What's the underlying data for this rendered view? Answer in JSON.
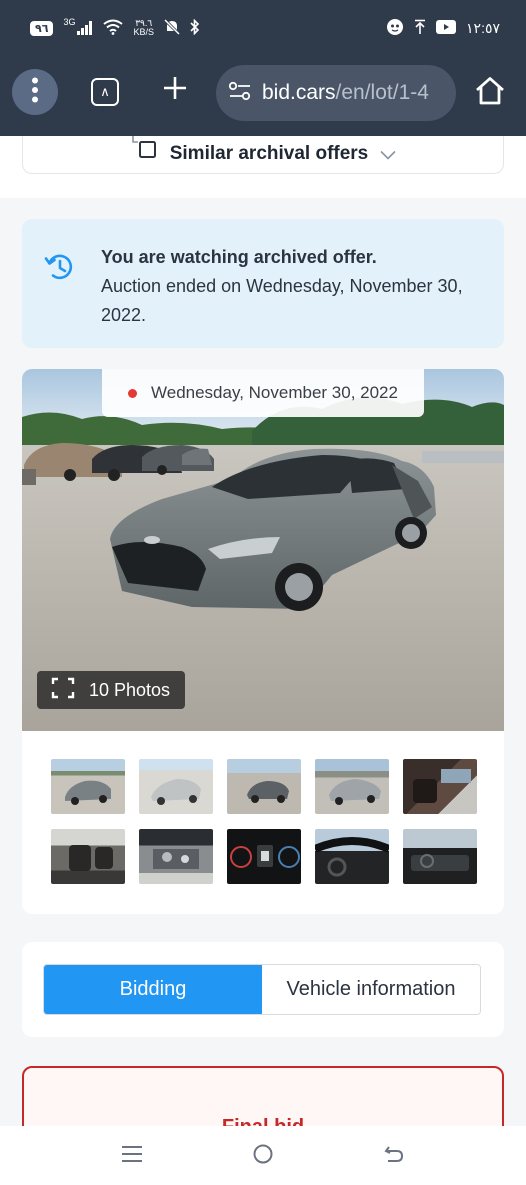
{
  "status_bar": {
    "battery": "٩٦",
    "network": "3G",
    "data_speed_value": "٣٩.٦",
    "data_speed_unit": "KB/S",
    "time": "١٢:٥٧",
    "icons": [
      "signal-icon",
      "wifi-icon",
      "mute-icon",
      "bluetooth-icon",
      "app-icon",
      "upload-icon",
      "youtube-icon"
    ]
  },
  "browser": {
    "url_domain": "bid.cars",
    "url_path": "/en/lot/1-4",
    "icons": [
      "menu-dots-icon",
      "tabs-icon",
      "new-tab-icon",
      "site-settings-icon",
      "home-icon"
    ]
  },
  "similar": {
    "label": "Similar archival offers"
  },
  "archive_notice": {
    "title": "You are watching archived offer.",
    "body": "Auction ended on Wednesday, November 30, 2022."
  },
  "gallery": {
    "date": "Wednesday, November 30, 2022",
    "photos_label": "10 Photos",
    "thumbnail_count": 10
  },
  "tabs": [
    {
      "label": "Bidding",
      "active": true
    },
    {
      "label": "Vehicle information",
      "active": false
    }
  ],
  "final_bid": {
    "title": "Final bid"
  },
  "colors": {
    "toolbar": "#2f3a4a",
    "accent": "#2196f3",
    "notice_bg": "#e3f1fb",
    "bid_border": "#c62828"
  }
}
